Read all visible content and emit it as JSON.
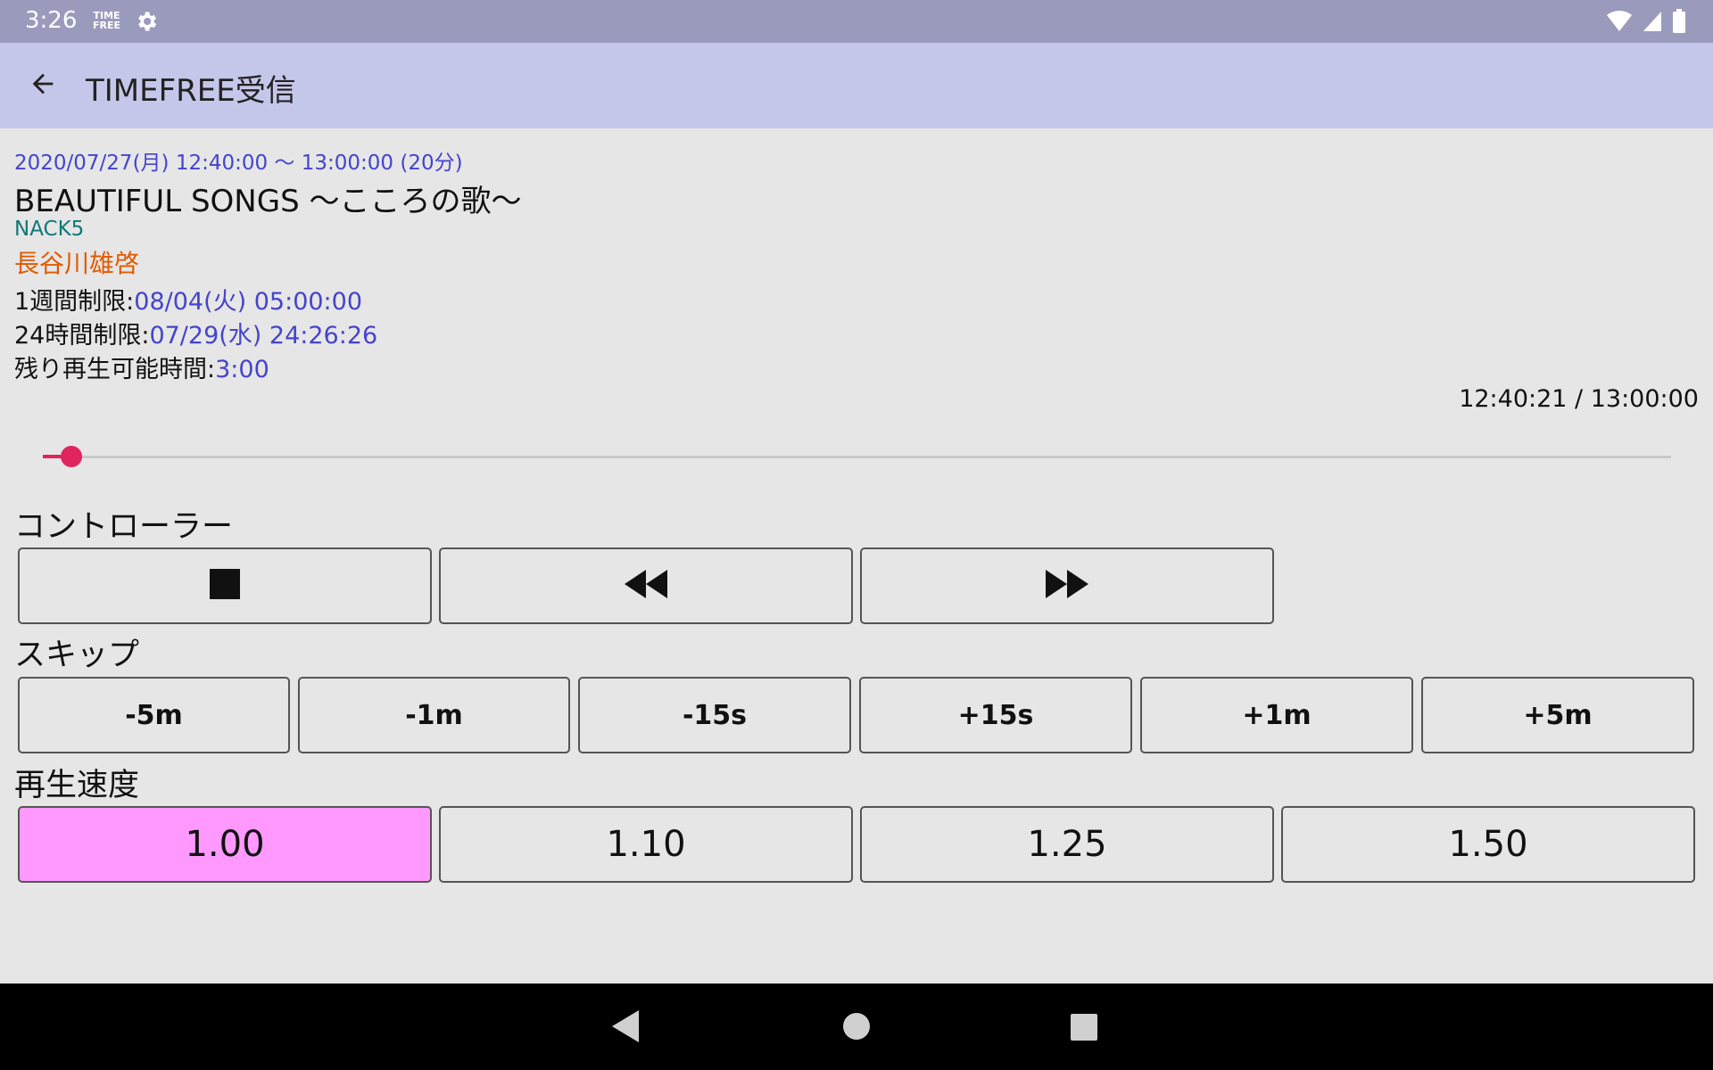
{
  "status_bar": {
    "time": "3:26",
    "app_badge_line1": "TIME",
    "app_badge_line2": "FREE"
  },
  "app_bar": {
    "title": "TIMEFREE受信"
  },
  "program": {
    "date_range": "2020/07/27(月) 12:40:00 〜 13:00:00 (20分)",
    "title": "BEAUTIFUL SONGS 〜こころの歌〜",
    "station": "NACK5",
    "personality": "長谷川雄啓",
    "week_limit_label": "1週間制限:",
    "week_limit_value": "08/04(火) 05:00:00",
    "day_limit_label": "24時間制限:",
    "day_limit_value": "07/29(水) 24:26:26",
    "remain_label": "残り再生可能時間:",
    "remain_value": "3:00"
  },
  "player": {
    "position_readout": "12:40:21 / 13:00:00",
    "progress": 0.0175
  },
  "controller": {
    "label": "コントローラー"
  },
  "skip": {
    "label": "スキップ",
    "buttons": [
      "-5m",
      "-1m",
      "-15s",
      "+15s",
      "+1m",
      "+5m"
    ]
  },
  "speed": {
    "label": "再生速度",
    "buttons": [
      "1.00",
      "1.10",
      "1.25",
      "1.50"
    ],
    "selected": "1.00"
  },
  "colors": {
    "accent": "#e0245e",
    "selected_speed": "#ff99ff",
    "link_blue": "#4444cc",
    "station_teal": "#117777",
    "personality_orange": "#e05a00"
  },
  "icons": [
    "back-arrow-icon",
    "stop-icon",
    "rewind-icon",
    "fast-forward-icon",
    "settings-gear-icon",
    "wifi-icon",
    "signal-icon",
    "battery-icon",
    "nav-back-icon",
    "nav-home-icon",
    "nav-recents-icon"
  ]
}
